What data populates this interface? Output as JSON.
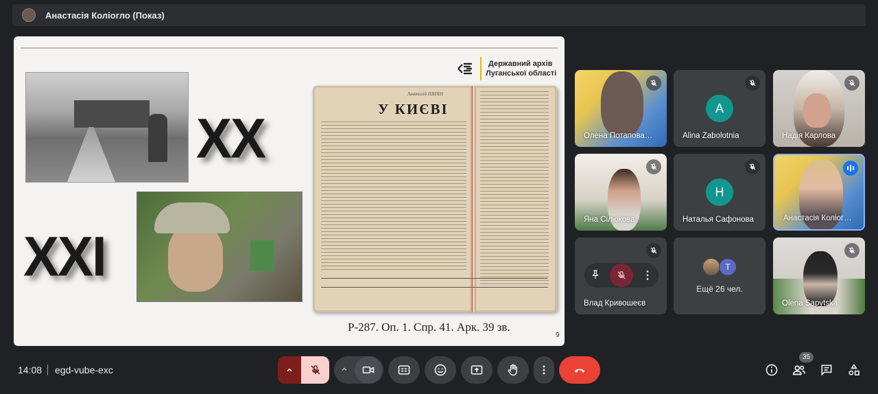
{
  "presenter_bar": {
    "title": "Анастасія Коліогло (Показ)"
  },
  "slide": {
    "archive_line1": "Державний архів",
    "archive_line2": "Луганської області",
    "century_20": "XX",
    "century_21": "XXI",
    "newspaper_author": "Анатолій ШИЯН",
    "newspaper_heading": "У КИЄВІ",
    "caption": "Р-287. Оп. 1. Спр. 41. Арк. 39 зв.",
    "page_number": "9"
  },
  "participants": [
    {
      "name": "Олена Потапова…",
      "muted": true,
      "type": "video"
    },
    {
      "name": "Alina Zabolotnia",
      "muted": true,
      "type": "avatar",
      "letter": "A"
    },
    {
      "name": "Надія Карлова",
      "muted": true,
      "type": "video"
    },
    {
      "name": "Яна Сілюкова",
      "muted": true,
      "type": "video"
    },
    {
      "name": "Наталья Сафонова",
      "muted": true,
      "type": "avatar",
      "letter": "H"
    },
    {
      "name": "Анастасія Коліог…",
      "muted": false,
      "speaking": true,
      "type": "video"
    },
    {
      "name": "Влад Кривошеєв",
      "muted": true,
      "type": "hover-controls"
    },
    {
      "name": "Ещё 26 чел.",
      "type": "more",
      "letter": "T"
    },
    {
      "name": "Olena Sapytska",
      "muted": true,
      "type": "video"
    }
  ],
  "bottom_bar": {
    "time": "14:08",
    "meeting_code": "egd-vube-exc",
    "participant_count": "35"
  },
  "colors": {
    "background": "#202124",
    "tile": "#3c4043",
    "end_call": "#ea4335",
    "mic_off": "#f8d0cd",
    "avatar_teal": "#12978f",
    "speaking_blue": "#1a73e8"
  }
}
